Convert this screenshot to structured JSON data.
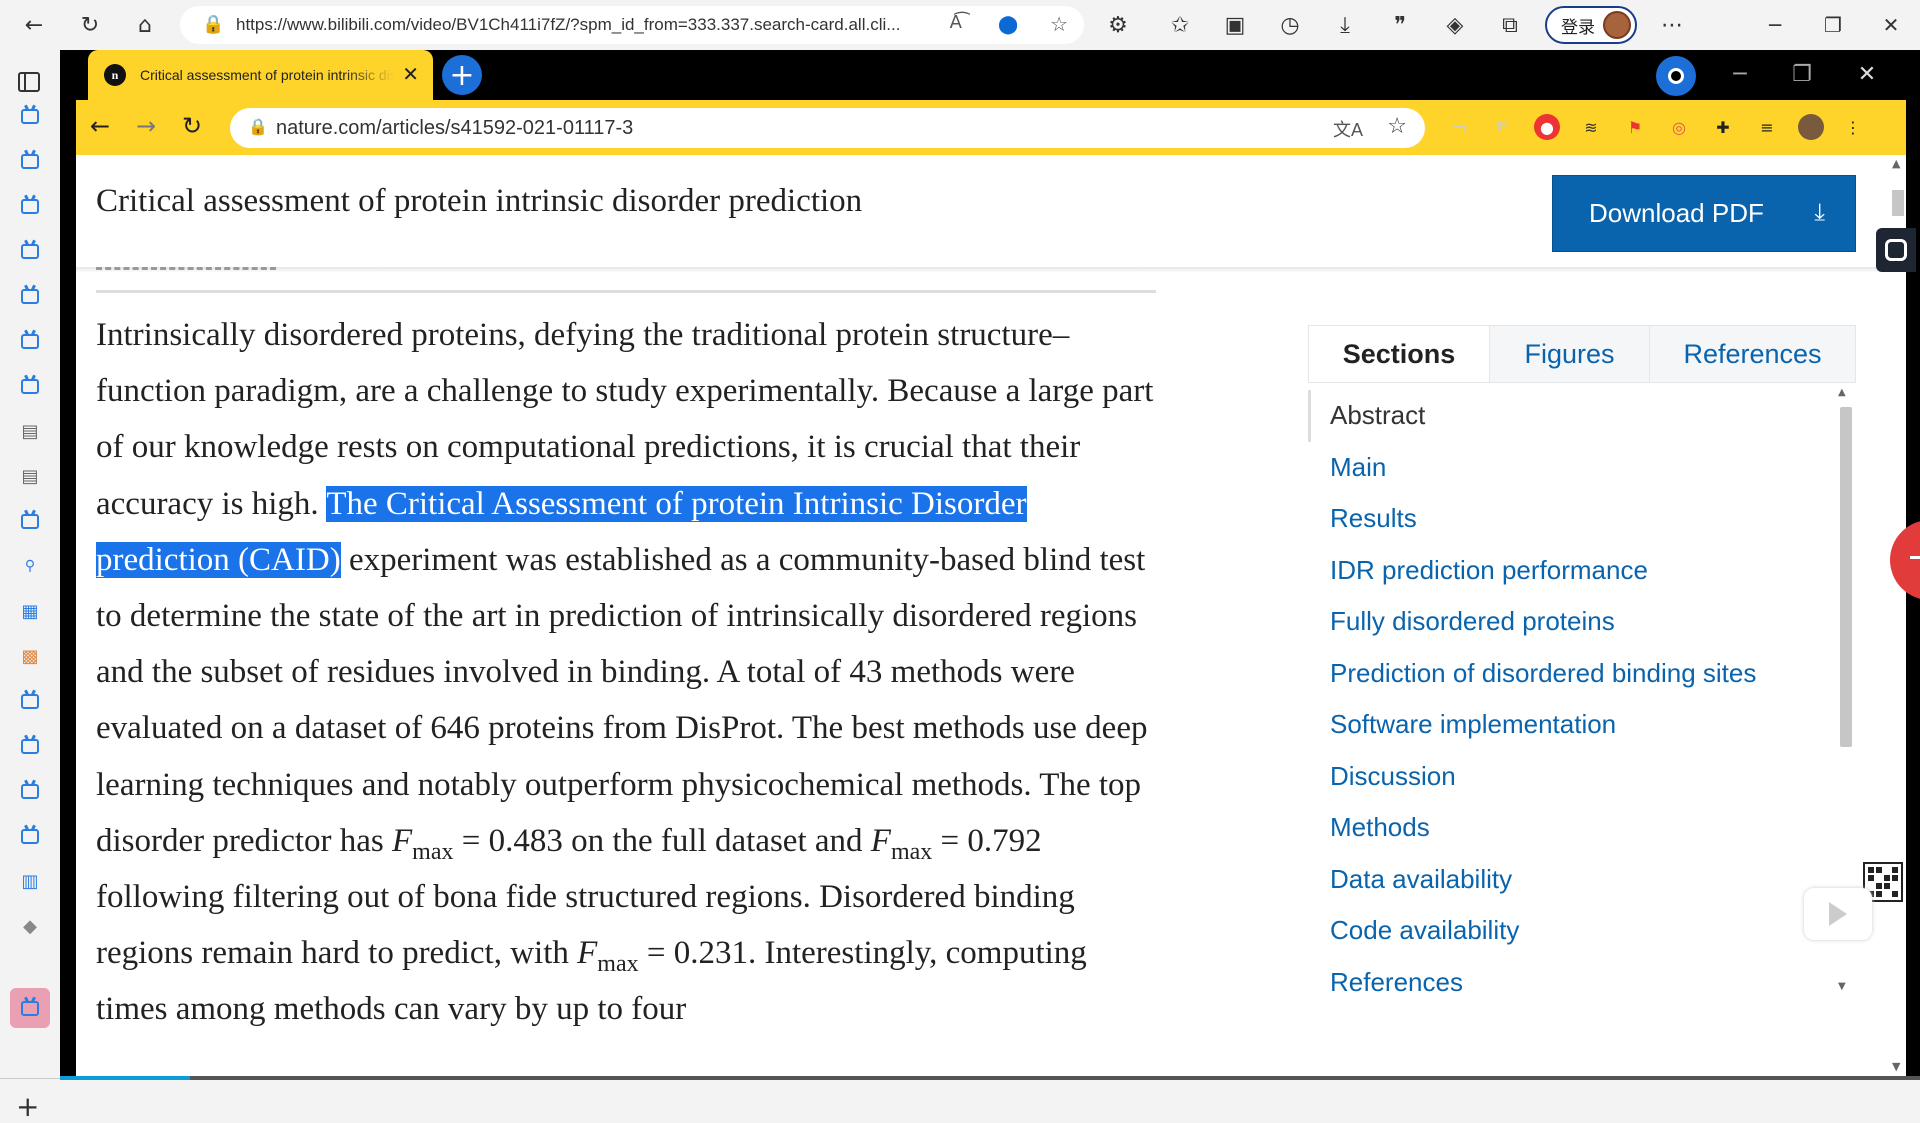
{
  "edge": {
    "url": "https://www.bilibili.com/video/BV1Ch411i7fZ/?spm_id_from=333.337.search-card.all.cli...",
    "login_label": "登录"
  },
  "chrome": {
    "tab_title": "Critical assessment of protein intrinsic disorder prediction",
    "tab_favicon": "n",
    "url": "nature.com/articles/s41592-021-01117-3"
  },
  "article": {
    "title": "Critical assessment of protein intrinsic disorder prediction",
    "download_label": "Download PDF",
    "abstract": {
      "p1": "Intrinsically disordered proteins, defying the traditional protein structure–function paradigm, are a challenge to study experimentally. Because a large part of our knowledge rests on computational predictions, it is crucial that their accuracy is high. ",
      "highlight": "The Critical Assessment of protein Intrinsic Disorder prediction (CAID)",
      "p2": " experiment was established as a community-based blind test to determine the state of the art in prediction of intrinsically disordered regions and the subset of residues involved in binding. A total of 43 methods were evaluated on a dataset of 646 proteins from DisProt. The best methods use deep learning techniques and notably outperform physicochemical methods. The top disorder predictor has ",
      "f": "F",
      "sub": "max",
      "v1": " = 0.483 on the full dataset and ",
      "v2": " = 0.792 following filtering out of bona fide structured regions. Disordered binding regions remain hard to predict, with ",
      "v3": " = 0.231. Interestingly, computing times among methods can vary by up to four"
    }
  },
  "panel": {
    "tabs": [
      "Sections",
      "Figures",
      "References"
    ],
    "sections": [
      "Abstract",
      "Main",
      "Results",
      "IDR prediction performance",
      "Fully disordered proteins",
      "Prediction of disordered binding sites",
      "Software implementation",
      "Discussion",
      "Methods",
      "Data availability",
      "Code availability",
      "References"
    ]
  },
  "colors": {
    "chrome_yellow": "#ffd42a",
    "nature_blue": "#0a64ad",
    "highlight": "#1a73e8"
  },
  "video_progress": 0.07
}
